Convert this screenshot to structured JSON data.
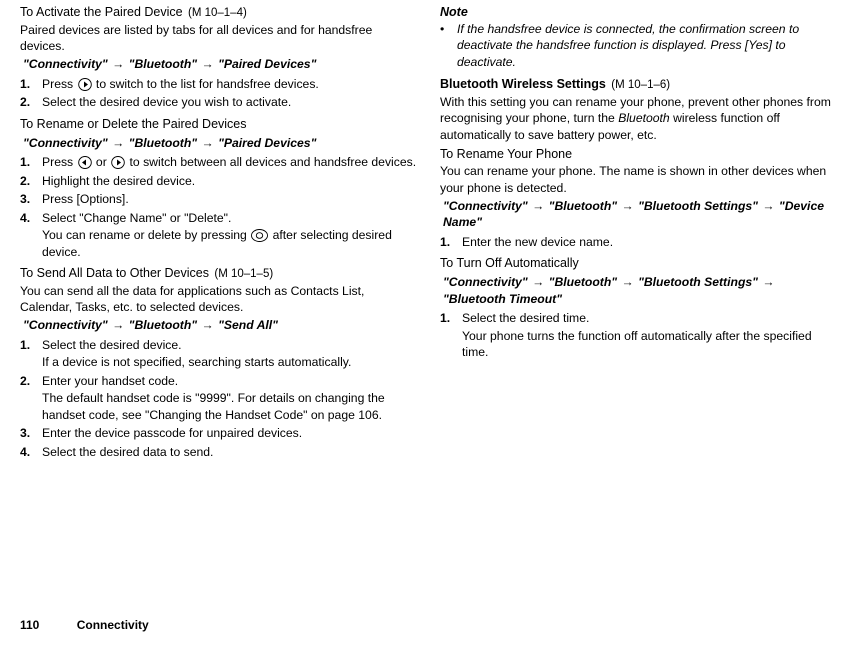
{
  "left": {
    "s1": {
      "title": "To Activate the Paired Device",
      "code": "(M 10–1–4)",
      "body": "Paired devices are listed by tabs for all devices and for handsfree devices.",
      "path_a": "\"Connectivity\"",
      "path_b": "\"Bluetooth\"",
      "path_c": "\"Paired Devices\"",
      "step1a": "Press ",
      "step1b": " to switch to the list for handsfree devices.",
      "step2": "Select the desired device you wish to activate."
    },
    "s2": {
      "title": "To Rename or Delete the Paired Devices",
      "path_a": "\"Connectivity\"",
      "path_b": "\"Bluetooth\"",
      "path_c": "\"Paired Devices\"",
      "step1a": "Press ",
      "step1b": " or ",
      "step1c": " to switch between all devices and handsfree devices.",
      "step2": "Highlight the desired device.",
      "step3": "Press [Options].",
      "step4": "Select \"Change Name\" or \"Delete\".",
      "step4suba": "You can rename or delete by pressing ",
      "step4subb": " after selecting desired device."
    },
    "s3": {
      "title": "To Send All Data to Other Devices",
      "code": "(M 10–1–5)",
      "body": "You can send all the data for applications such as Contacts List, Calendar, Tasks, etc. to selected devices.",
      "path_a": "\"Connectivity\"",
      "path_b": "\"Bluetooth\"",
      "path_c": "\"Send All\"",
      "step1": "Select the desired device.",
      "step1sub": "If a device is not specified, searching starts automatically.",
      "step2": "Enter your handset code.",
      "step2sub": "The default handset code is \"9999\". For details on changing the handset code, see \"Changing the Handset Code\" on page 106.",
      "step3": "Enter the device passcode for unpaired devices.",
      "step4": "Select the desired data to send."
    }
  },
  "right": {
    "note": {
      "head": "Note",
      "body": "If the handsfree device is connected, the confirmation screen to deactivate the handsfree function is displayed. Press [Yes] to deactivate."
    },
    "s4": {
      "title": "Bluetooth Wireless Settings",
      "code": "(M 10–1–6)",
      "body1": "With this setting you can rename your phone, prevent other phones from recognising your phone, turn the ",
      "body2": "Bluetooth",
      "body3": " wireless function off automatically to save battery power, etc."
    },
    "s5": {
      "title": "To Rename Your Phone",
      "body": "You can rename your phone. The name is shown in other devices when your phone is detected.",
      "path_a": "\"Connectivity\"",
      "path_b": "\"Bluetooth\"",
      "path_c": "\"Bluetooth Settings\"",
      "path_d": "\"Device Name\"",
      "step1": "Enter the new device name."
    },
    "s6": {
      "title": "To Turn Off Automatically",
      "path_a": "\"Connectivity\"",
      "path_b": "\"Bluetooth\"",
      "path_c": "\"Bluetooth Settings\"",
      "path_d": "\"Bluetooth Timeout\"",
      "step1": "Select the desired time.",
      "step1sub": "Your phone turns the function off automatically after the specified time."
    }
  },
  "footer": {
    "page": "110",
    "section": "Connectivity"
  },
  "arrow": "→"
}
